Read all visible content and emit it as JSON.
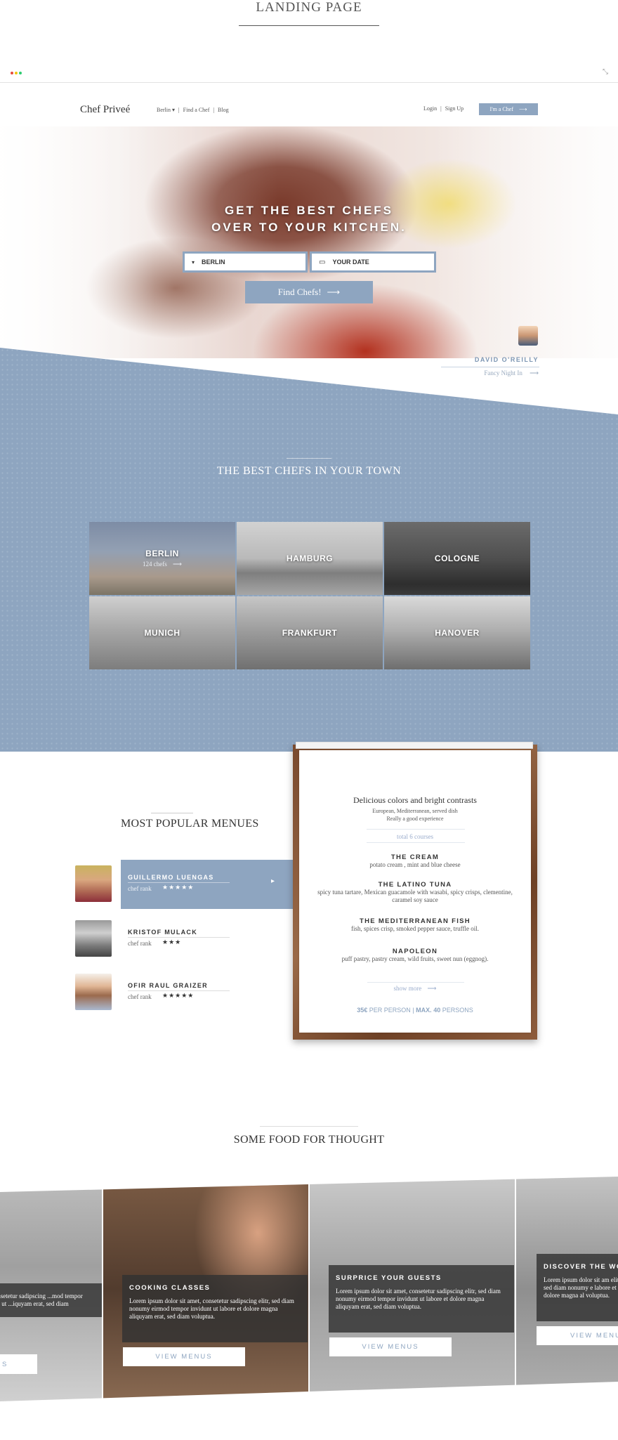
{
  "presentation": {
    "title": "LANDING PAGE"
  },
  "browser": {
    "dot_colors": [
      "#e74c3c",
      "#f1c40f",
      "#2ecc71"
    ],
    "expand_icon": "⤡"
  },
  "nav": {
    "logo": "Chef Priveé",
    "city": "Berlin",
    "city_caret": "▾",
    "sep1": "|",
    "find_chef": "Find a Chef",
    "sep2": "|",
    "blog": "Blog",
    "login": "Login",
    "auth_sep": "|",
    "signup": "Sign Up",
    "chef_button": "I'm a Chef",
    "chef_button_arrow": "⟶"
  },
  "hero": {
    "headline_line1": "GET THE BEST CHEFS",
    "headline_line2": "OVER TO YOUR KITCHEN.",
    "city_caret": "▾",
    "city_value": "BERLIN",
    "date_icon": "▭",
    "date_placeholder": "YOUR DATE",
    "find_button": "Find Chefs!",
    "find_arrow": "⟶",
    "featured_chef_name": "DAVID O'REILLY",
    "featured_chef_menu": "Fancy Night In",
    "featured_chef_arrow": "⟶"
  },
  "cities": {
    "title": "THE BEST CHEFS IN YOUR TOWN",
    "items": [
      {
        "name": "BERLIN",
        "count": "124 chefs",
        "arrow": "⟶"
      },
      {
        "name": "HAMBURG"
      },
      {
        "name": "COLOGNE"
      },
      {
        "name": "MUNICH"
      },
      {
        "name": "FRANKFURT"
      },
      {
        "name": "HANOVER"
      }
    ]
  },
  "menus": {
    "title": "MOST POPULAR MENUES",
    "chefs": [
      {
        "name": "GUILLERMO LUENGAS",
        "rank_label": "chef rank",
        "stars": "★★★★★",
        "active": true,
        "arrow": "▸"
      },
      {
        "name": "KRISTOF MULACK",
        "rank_label": "chef rank",
        "stars": "★★★"
      },
      {
        "name": "OFIR RAUL GRAIZER",
        "rank_label": "chef rank",
        "stars": "★★★★★"
      }
    ],
    "card": {
      "title": "Delicious colors and bright contrasts",
      "sub1": "European, Mediterranean, served dish",
      "sub2": "Really a good experience",
      "courses": "total 6 courses",
      "dishes": [
        {
          "name": "THE CREAM",
          "desc": "potato cream , mint and blue cheese"
        },
        {
          "name": "THE LATINO TUNA",
          "desc": "spicy tuna tartare, Mexican guacamole with wasabi, spicy crisps, clementine, caramel soy sauce"
        },
        {
          "name": "THE MEDITERRANEAN FISH",
          "desc": "fish, spices crisp, smoked pepper sauce, truffle oil."
        },
        {
          "name": "NAPOLEON",
          "desc": "puff pastry, pastry cream, wild fruits, sweet nun (eggnog)."
        }
      ],
      "show_more": "show more",
      "show_more_arrow": "⟶",
      "price": "35€",
      "per_person": "PER PERSON |",
      "max_label": "MAX.",
      "max_count": "40",
      "persons": "PERSONS"
    }
  },
  "thought": {
    "title": "SOME FOOD FOR THOUGHT",
    "cards": [
      {
        "title": "",
        "text": "...et, consetetur sadipscing ...mod tempor invidunt ut ...iquyam erat, sed diam",
        "button": "S"
      },
      {
        "title": "COOKING CLASSES",
        "text": "Lorem ipsum dolor sit amet, consetetur sadipscing elitr, sed diam nonumy eirmod tempor invidunt ut labore et dolore magna aliquyam erat, sed diam voluptua.",
        "button": "VIEW MENUS"
      },
      {
        "title": "SURPRICE YOUR GUESTS",
        "text": "Lorem ipsum dolor sit amet, consetetur sadipscing elitr, sed diam nonumy eirmod tempor invidunt ut labore et dolore magna aliquyam erat, sed diam voluptua.",
        "button": "VIEW MENUS"
      },
      {
        "title": "DISCOVER THE WO",
        "text": "Lorem ipsum dolor sit am elitr, sed diam nonumy e labore et dolore magna al voluptua.",
        "button": "VIEW MENU"
      }
    ]
  }
}
